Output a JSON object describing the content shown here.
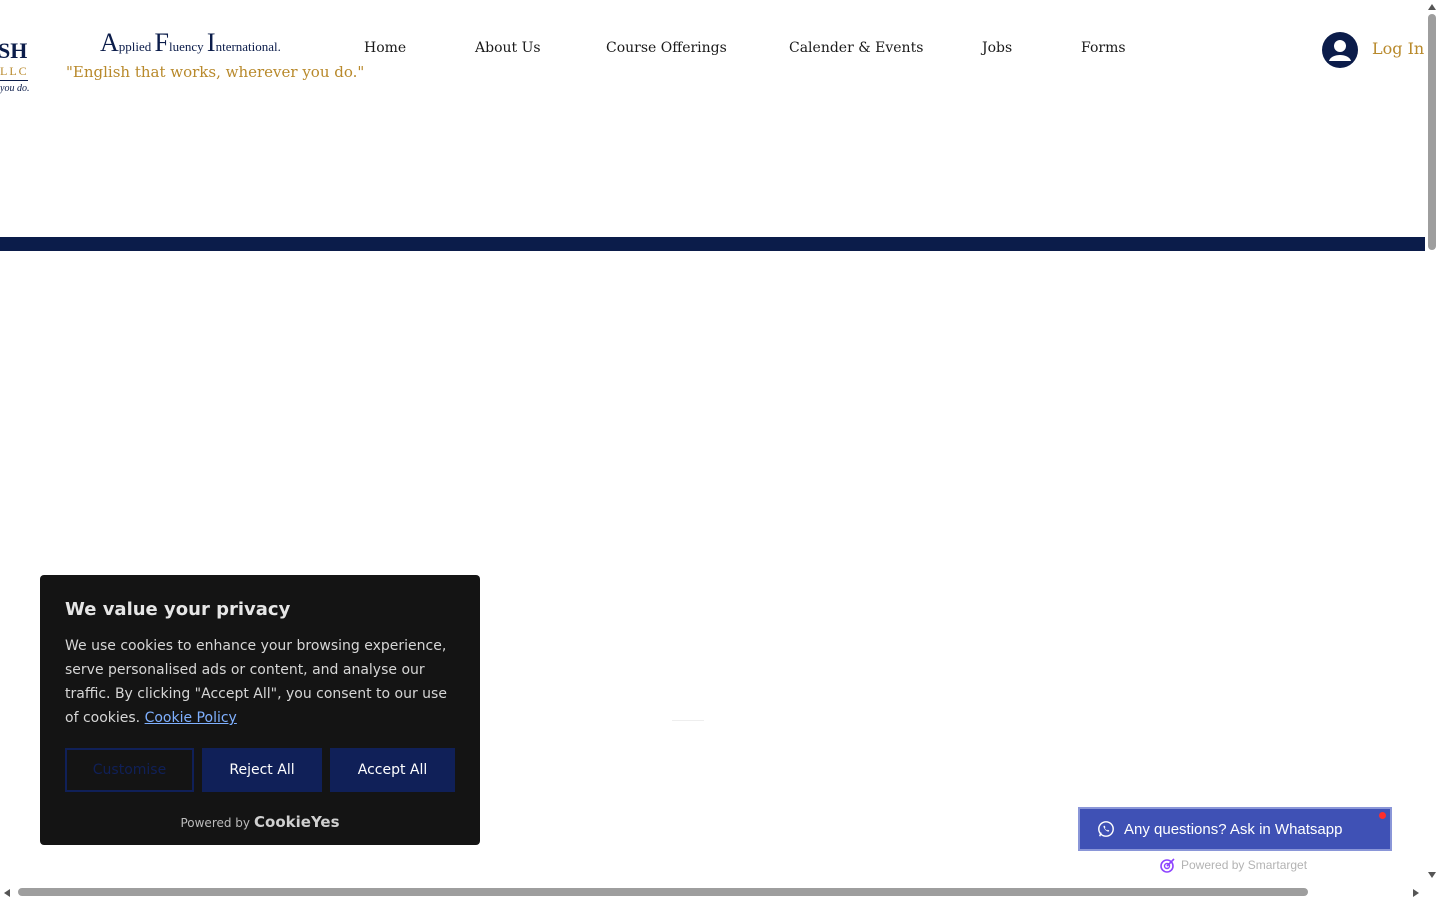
{
  "header": {
    "logo_fragment": {
      "line1": "SH",
      "line2": "LLC",
      "line3": "you do."
    },
    "brand_name_parts": [
      {
        "text": "A",
        "size": "big"
      },
      {
        "text": "pplied ",
        "size": "small"
      },
      {
        "text": "F",
        "size": "big"
      },
      {
        "text": "luency ",
        "size": "small"
      },
      {
        "text": "I",
        "size": "big"
      },
      {
        "text": "nternational.",
        "size": "small"
      }
    ],
    "tagline": "\"English that works, wherever you do.\"",
    "nav_items": [
      {
        "label": "Home"
      },
      {
        "label": "About Us"
      },
      {
        "label": "Course Offerings"
      },
      {
        "label": "Calender & Events"
      },
      {
        "label": "Jobs"
      },
      {
        "label": "Forms"
      }
    ],
    "login_label": "Log In"
  },
  "cookie_banner": {
    "title": "We value your privacy",
    "body": "We use cookies to enhance your browsing experience, serve personalised ads or content, and analyse our traffic. By clicking \"Accept All\", you consent to our use of cookies.",
    "policy_link": "Cookie Policy",
    "customise_label": "Customise",
    "reject_label": "Reject All",
    "accept_label": "Accept All",
    "powered_by": "Powered by",
    "powered_brand": "CookieYes"
  },
  "whatsapp_widget": {
    "label": "Any questions? Ask in Whatsapp",
    "powered_by": "Powered by Smartarget"
  },
  "colors": {
    "navy": "#0b1c4a",
    "gold": "#b8892b",
    "button_navy": "#102058",
    "whatsapp_bg": "#3f51b5"
  }
}
